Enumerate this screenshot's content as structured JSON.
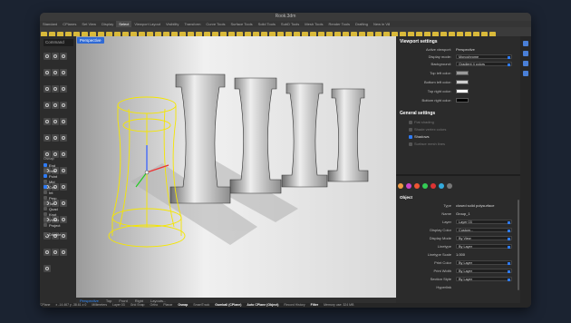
{
  "window": {
    "title": "Rook.3dm"
  },
  "menu_tabs": [
    "Standard",
    "CPlanes",
    "Set View",
    "Display",
    "Select",
    "Viewport Layout",
    "Visibility",
    "Transform",
    "Curve Tools",
    "Surface Tools",
    "Solid Tools",
    "SubD Tools",
    "Mesh Tools",
    "Render Tools",
    "Drafting",
    "New in V8"
  ],
  "active_menu_tab": "Select",
  "command": {
    "placeholder": "Command"
  },
  "osnap": {
    "items": [
      {
        "label": "End",
        "on": true
      },
      {
        "label": "Near",
        "on": false
      },
      {
        "label": "Point",
        "on": true
      },
      {
        "label": "Mid",
        "on": false
      },
      {
        "label": "Cen",
        "on": true
      },
      {
        "label": "Int",
        "on": false
      },
      {
        "label": "Perp",
        "on": false
      },
      {
        "label": "Tan",
        "on": false
      },
      {
        "label": "Quad",
        "on": false
      },
      {
        "label": "Knot",
        "on": false
      },
      {
        "label": "Vertex",
        "on": false
      },
      {
        "label": "Project",
        "on": false
      }
    ],
    "disable_label": "Disable"
  },
  "viewport": {
    "title": "Perspective",
    "tabs": [
      "Perspective",
      "Top",
      "Front",
      "Right",
      "Layouts..."
    ],
    "active_tab": "Perspective"
  },
  "panel": {
    "viewport_settings": {
      "title": "Viewport settings",
      "active_viewport_label": "Active viewport:",
      "active_viewport": "Perspective",
      "display_mode_label": "Display mode:",
      "display_mode": "Monochrome",
      "background_label": "Background:",
      "background": "Gradient 4 colors",
      "top_left_label": "Top left color:",
      "bottom_left_label": "Bottom left color:",
      "top_right_label": "Top right color:",
      "bottom_right_label": "Bottom right color:",
      "colors": {
        "top_left": "#9a9a9a",
        "bottom_left": "#cfcfcf",
        "top_right": "#ffffff",
        "bottom_right": "#000000"
      }
    },
    "general_settings": {
      "title": "General settings",
      "options": [
        {
          "label": "Flat shading",
          "on": false
        },
        {
          "label": "Shade vertex colors",
          "on": false
        },
        {
          "label": "Shadows",
          "on": true
        },
        {
          "label": "Surface mesh lines",
          "on": false
        }
      ]
    },
    "object": {
      "title": "Object",
      "type_label": "Type",
      "type": "closed solid polysurface",
      "name_label": "Name",
      "name": "Group_1",
      "layer_label": "Layer",
      "layer": "Layer 03",
      "display_color_label": "Display Color",
      "display_color": "Custom...",
      "display_mode_label": "Display Mode",
      "display_mode": "By View",
      "linetype_label": "Linetype",
      "linetype": "By Layer",
      "linetype_scale_label": "Linetype Scale",
      "linetype_scale": "1.000",
      "print_color_label": "Print Color",
      "print_color": "By Layer",
      "print_width_label": "Print Width",
      "print_width": "By Layer",
      "section_style_label": "Section Style",
      "section_style": "By Layer",
      "hyperlink_label": "Hyperlink",
      "hyperlink": ""
    }
  },
  "status": {
    "cplane": "CPlane",
    "coords": "x -14.467  y -38.61  z 0",
    "units": "Millimeters",
    "layer": "Layer 03",
    "items": [
      "Grid Snap",
      "Ortho",
      "Planar",
      "Osnap",
      "SmartTrack",
      "Gumball (CPlane)",
      "Auto CPlane (Object)",
      "Record History",
      "Filter"
    ],
    "bold_items": [
      "Osnap",
      "Gumball (CPlane)",
      "Auto CPlane (Object)",
      "Filter"
    ],
    "memory": "Memory use: 324 MB"
  },
  "colors": {
    "accent": "#2f7bf5",
    "selection": "#f5e600"
  }
}
